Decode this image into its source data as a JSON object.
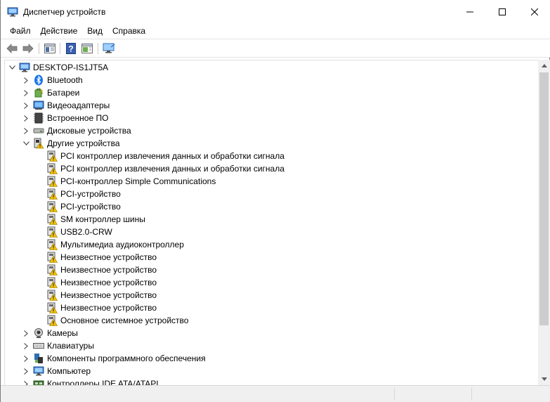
{
  "window": {
    "title": "Диспетчер устройств"
  },
  "menu": {
    "items": [
      "Файл",
      "Действие",
      "Вид",
      "Справка"
    ]
  },
  "toolbar": {
    "buttons": [
      "back-icon",
      "forward-icon",
      "properties-icon",
      "help-icon",
      "action-pane-icon",
      "monitor-icon"
    ]
  },
  "tree": {
    "root": "DESKTOP-IS1JT5A",
    "categories_before": [
      {
        "label": "Bluetooth",
        "icon": "bluetooth-icon"
      },
      {
        "label": "Батареи",
        "icon": "battery-icon"
      },
      {
        "label": "Видеоадаптеры",
        "icon": "display-adapter-icon"
      },
      {
        "label": "Встроенное ПО",
        "icon": "firmware-icon"
      },
      {
        "label": "Дисковые устройства",
        "icon": "disk-drive-icon"
      }
    ],
    "expanded_category": {
      "label": "Другие устройства",
      "icon": "other-devices-icon"
    },
    "other_devices": [
      "PCI контроллер извлечения данных и обработки сигнала",
      "PCI контроллер извлечения данных и обработки сигнала",
      "PCI-контроллер Simple Communications",
      "PCI-устройство",
      "PCI-устройство",
      "SM контроллер шины",
      "USB2.0-CRW",
      "Мультимедиа аудиоконтроллер",
      "Неизвестное устройство",
      "Неизвестное устройство",
      "Неизвестное устройство",
      "Неизвестное устройство",
      "Неизвестное устройство",
      "Основное системное устройство"
    ],
    "categories_after": [
      {
        "label": "Камеры",
        "icon": "camera-icon"
      },
      {
        "label": "Клавиатуры",
        "icon": "keyboard-icon"
      },
      {
        "label": "Компоненты программного обеспечения",
        "icon": "software-component-icon"
      },
      {
        "label": "Компьютер",
        "icon": "computer-icon"
      },
      {
        "label": "Контроллеры IDE ATA/ATAPI",
        "icon": "ide-controller-icon"
      }
    ]
  },
  "colors": {
    "warning": "#f5c400",
    "accent": "#0078d7",
    "selection": "#cce8ff"
  }
}
